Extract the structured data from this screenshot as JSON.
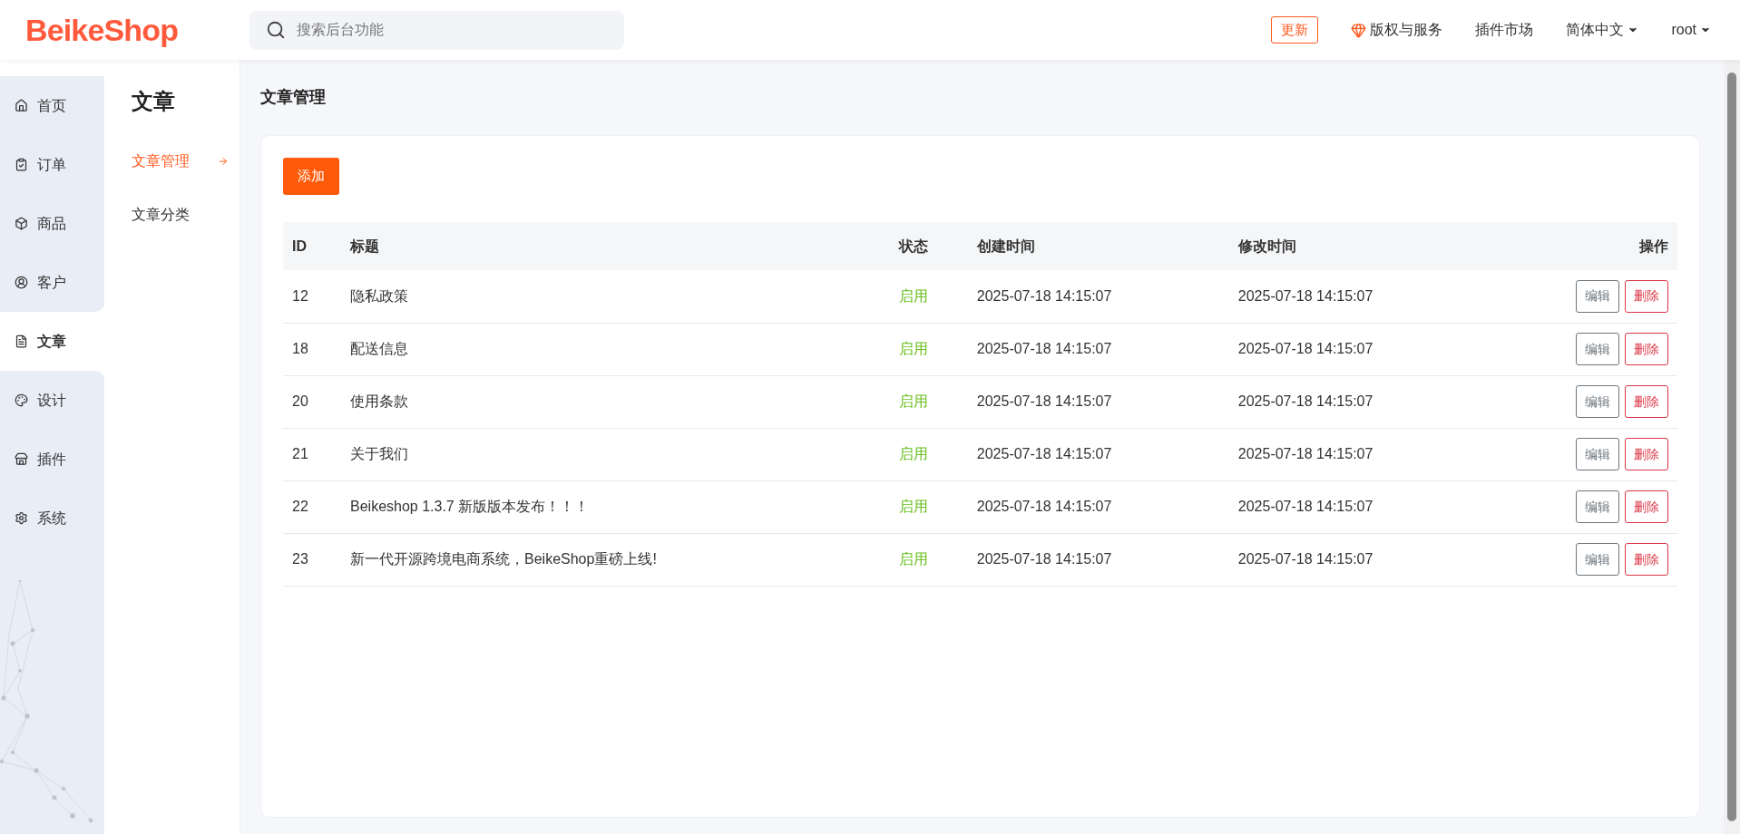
{
  "header": {
    "logo": "BeikeShop",
    "search": {
      "placeholder": "搜索后台功能"
    },
    "update_badge": "更新",
    "links": [
      {
        "label": "版权与服务",
        "kind": "gem"
      },
      {
        "label": "插件市场",
        "kind": "plain"
      },
      {
        "label": "简体中文",
        "kind": "dropdown"
      },
      {
        "label": "root",
        "kind": "dropdown"
      }
    ]
  },
  "sidebar": {
    "items": [
      {
        "label": "首页",
        "selected": false
      },
      {
        "label": "订单",
        "selected": false
      },
      {
        "label": "商品",
        "selected": false
      },
      {
        "label": "客户",
        "selected": false
      },
      {
        "label": "文章",
        "selected": true
      },
      {
        "label": "设计",
        "selected": false
      },
      {
        "label": "插件",
        "selected": false
      },
      {
        "label": "系统",
        "selected": false
      }
    ]
  },
  "submenu": {
    "title": "文章",
    "items": [
      {
        "label": "文章管理",
        "selected": true
      },
      {
        "label": "文章分类",
        "selected": false
      }
    ]
  },
  "page_title": "文章管理",
  "add_button": "添加",
  "table": {
    "columns": [
      "ID",
      "标题",
      "状态",
      "创建时间",
      "修改时间",
      "操作"
    ],
    "rows": [
      {
        "id": "12",
        "title": "隐私政策",
        "status": "启用",
        "enabled": true,
        "created": "2025-07-18 14:15:07",
        "modified": "2025-07-18 14:15:07",
        "edit": "编辑",
        "delete": "删除"
      },
      {
        "id": "18",
        "title": "配送信息",
        "status": "启用",
        "enabled": true,
        "created": "2025-07-18 14:15:07",
        "modified": "2025-07-18 14:15:07",
        "edit": "编辑",
        "delete": "删除"
      },
      {
        "id": "20",
        "title": "使用条款",
        "status": "启用",
        "enabled": true,
        "created": "2025-07-18 14:15:07",
        "modified": "2025-07-18 14:15:07",
        "edit": "编辑",
        "delete": "删除"
      },
      {
        "id": "21",
        "title": "关于我们",
        "status": "启用",
        "enabled": true,
        "created": "2025-07-18 14:15:07",
        "modified": "2025-07-18 14:15:07",
        "edit": "编辑",
        "delete": "删除"
      },
      {
        "id": "22",
        "title": "Beikeshop 1.3.7 新版版本发布！！！",
        "status": "启用",
        "enabled": true,
        "created": "2025-07-18 14:15:07",
        "modified": "2025-07-18 14:15:07",
        "edit": "编辑",
        "delete": "删除"
      },
      {
        "id": "23",
        "title": "新一代开源跨境电商系统，BeikeShop重磅上线!",
        "status": "启用",
        "enabled": true,
        "created": "2025-07-18 14:15:07",
        "modified": "2025-07-18 14:15:07",
        "edit": "编辑",
        "delete": "删除"
      }
    ]
  }
}
